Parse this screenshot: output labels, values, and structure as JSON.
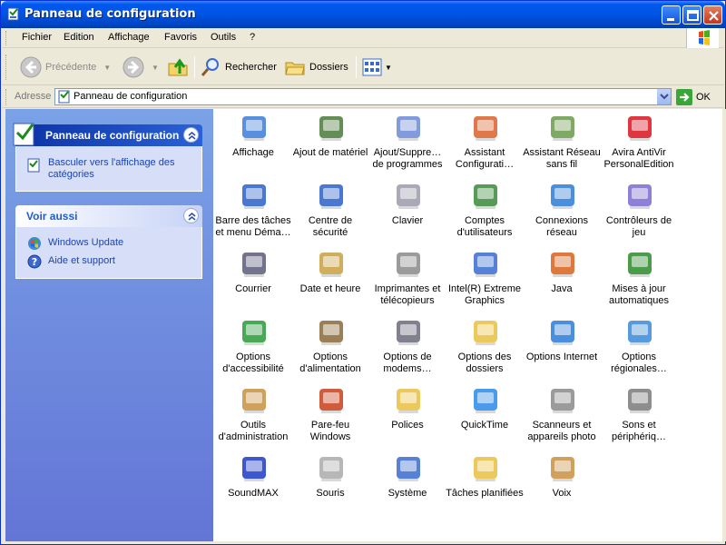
{
  "window": {
    "title": "Panneau de configuration"
  },
  "menu": [
    "Fichier",
    "Edition",
    "Affichage",
    "Favoris",
    "Outils",
    "?"
  ],
  "toolbar": {
    "back_label": "Précédente",
    "search_label": "Rechercher",
    "folders_label": "Dossiers"
  },
  "address": {
    "label": "Adresse",
    "value": "Panneau de configuration",
    "go_label": "OK"
  },
  "sidebar": {
    "panel1": {
      "title": "Panneau de configuration",
      "link": "Basculer vers l'affichage des catégories"
    },
    "panel2": {
      "title": "Voir aussi",
      "links": [
        "Windows Update",
        "Aide et support"
      ]
    }
  },
  "items": [
    {
      "label": "Affichage",
      "icon": "display-icon",
      "color": "#3b7bd8"
    },
    {
      "label": "Ajout de matériel",
      "icon": "add-hardware-icon",
      "color": "#4a7a3a"
    },
    {
      "label": "Ajout/Suppre… de programmes",
      "icon": "add-remove-programs-icon",
      "color": "#6b8ad6"
    },
    {
      "label": "Assistant Configurati…",
      "icon": "network-setup-icon",
      "color": "#d9622b"
    },
    {
      "label": "Assistant Réseau sans fil",
      "icon": "wireless-network-icon",
      "color": "#6a9a4a"
    },
    {
      "label": "Avira AntiVir PersonalEdition",
      "icon": "avira-icon",
      "color": "#d8141e"
    },
    {
      "label": "Barre des tâches et menu Déma…",
      "icon": "taskbar-icon",
      "color": "#2a5fc8"
    },
    {
      "label": "Centre de sécurité",
      "icon": "security-center-icon",
      "color": "#2a5fc8"
    },
    {
      "label": "Clavier",
      "icon": "keyboard-icon",
      "color": "#9a9aaa"
    },
    {
      "label": "Comptes d'utilisateurs",
      "icon": "user-accounts-icon",
      "color": "#3a8a3a"
    },
    {
      "label": "Connexions réseau",
      "icon": "network-connections-icon",
      "color": "#2a7ad8"
    },
    {
      "label": "Contrôleurs de jeu",
      "icon": "game-controllers-icon",
      "color": "#7a6ad0"
    },
    {
      "label": "Courrier",
      "icon": "mail-icon",
      "color": "#5a5a7a"
    },
    {
      "label": "Date et heure",
      "icon": "date-time-icon",
      "color": "#c8a040"
    },
    {
      "label": "Imprimantes et télécopieurs",
      "icon": "printers-icon",
      "color": "#8a8a8a"
    },
    {
      "label": "Intel(R) Extreme Graphics",
      "icon": "intel-graphics-icon",
      "color": "#3a6ad0"
    },
    {
      "label": "Java",
      "icon": "java-icon",
      "color": "#d8601a"
    },
    {
      "label": "Mises à jour automatiques",
      "icon": "automatic-updates-icon",
      "color": "#2a8a2a"
    },
    {
      "label": "Options d'accessibilité",
      "icon": "accessibility-icon",
      "color": "#2a9a3a"
    },
    {
      "label": "Options d'alimentation",
      "icon": "power-options-icon",
      "color": "#8a6a3a"
    },
    {
      "label": "Options de modems…",
      "icon": "modem-icon",
      "color": "#6a6a7a"
    },
    {
      "label": "Options des dossiers",
      "icon": "folder-options-icon",
      "color": "#e8c040"
    },
    {
      "label": "Options Internet",
      "icon": "internet-options-icon",
      "color": "#2a7ad8"
    },
    {
      "label": "Options régionales…",
      "icon": "regional-options-icon",
      "color": "#3a8ad8"
    },
    {
      "label": "Outils d'administration",
      "icon": "admin-tools-icon",
      "color": "#c89040"
    },
    {
      "label": "Pare-feu Windows",
      "icon": "firewall-icon",
      "color": "#c8401a"
    },
    {
      "label": "Polices",
      "icon": "fonts-icon",
      "color": "#e8c040"
    },
    {
      "label": "QuickTime",
      "icon": "quicktime-icon",
      "color": "#2a8ae8"
    },
    {
      "label": "Scanneurs et appareils photo",
      "icon": "scanners-cameras-icon",
      "color": "#8a8a8a"
    },
    {
      "label": "Sons et périphériq…",
      "icon": "sounds-icon",
      "color": "#7a7a7a"
    },
    {
      "label": "SoundMAX",
      "icon": "soundmax-icon",
      "color": "#1a3ac8"
    },
    {
      "label": "Souris",
      "icon": "mouse-icon",
      "color": "#aaaaaa"
    },
    {
      "label": "Système",
      "icon": "system-icon",
      "color": "#3a6ad0"
    },
    {
      "label": "Tâches planifiées",
      "icon": "scheduled-tasks-icon",
      "color": "#e8c040"
    },
    {
      "label": "Voix",
      "icon": "speech-icon",
      "color": "#c89040"
    }
  ]
}
